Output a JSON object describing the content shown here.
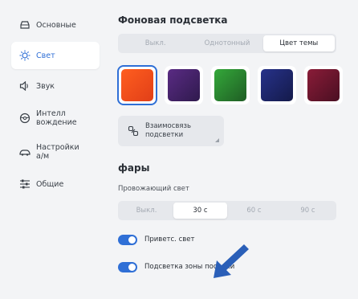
{
  "sidebar": {
    "items": [
      {
        "label": "Основные",
        "icon": "car-icon"
      },
      {
        "label": "Свет",
        "icon": "light-icon"
      },
      {
        "label": "Звук",
        "icon": "speaker-icon"
      },
      {
        "label": "Интелл\nвождение",
        "icon": "steering-wheel-icon"
      },
      {
        "label": "Настройки\nа/м",
        "icon": "car-settings-icon"
      },
      {
        "label": "Общие",
        "icon": "sliders-icon"
      }
    ],
    "active_index": 1
  },
  "backlight": {
    "title": "Фоновая подсветка",
    "modes": [
      "Выкл.",
      "Однотонный",
      "Цвет темы"
    ],
    "selected_mode": "Цвет темы",
    "swatches": [
      {
        "name": "orange",
        "from": "#ff5e1f",
        "to": "#e13f18"
      },
      {
        "name": "purple",
        "from": "#5a2b84",
        "to": "#2f1a4d"
      },
      {
        "name": "green",
        "from": "#34a83a",
        "to": "#1f5d24"
      },
      {
        "name": "navy",
        "from": "#27328a",
        "to": "#141a4a"
      },
      {
        "name": "crimson",
        "from": "#8a1c38",
        "to": "#4a0f22"
      }
    ],
    "selected_swatch": 0,
    "link_button": "Взаимосвязь\nподсветки"
  },
  "headlights": {
    "title": "фары",
    "escort_label": "Провожающий свет",
    "escort_options": [
      "Выкл.",
      "30 с",
      "60 с",
      "90 с"
    ],
    "escort_selected": "30 с",
    "toggles": [
      {
        "label": "Приветс. свет",
        "on": true
      },
      {
        "label": "Подсветка зоны посадки",
        "on": true
      }
    ]
  },
  "colors": {
    "accent": "#2f6fd6",
    "arrow": "#2a5fb8"
  }
}
